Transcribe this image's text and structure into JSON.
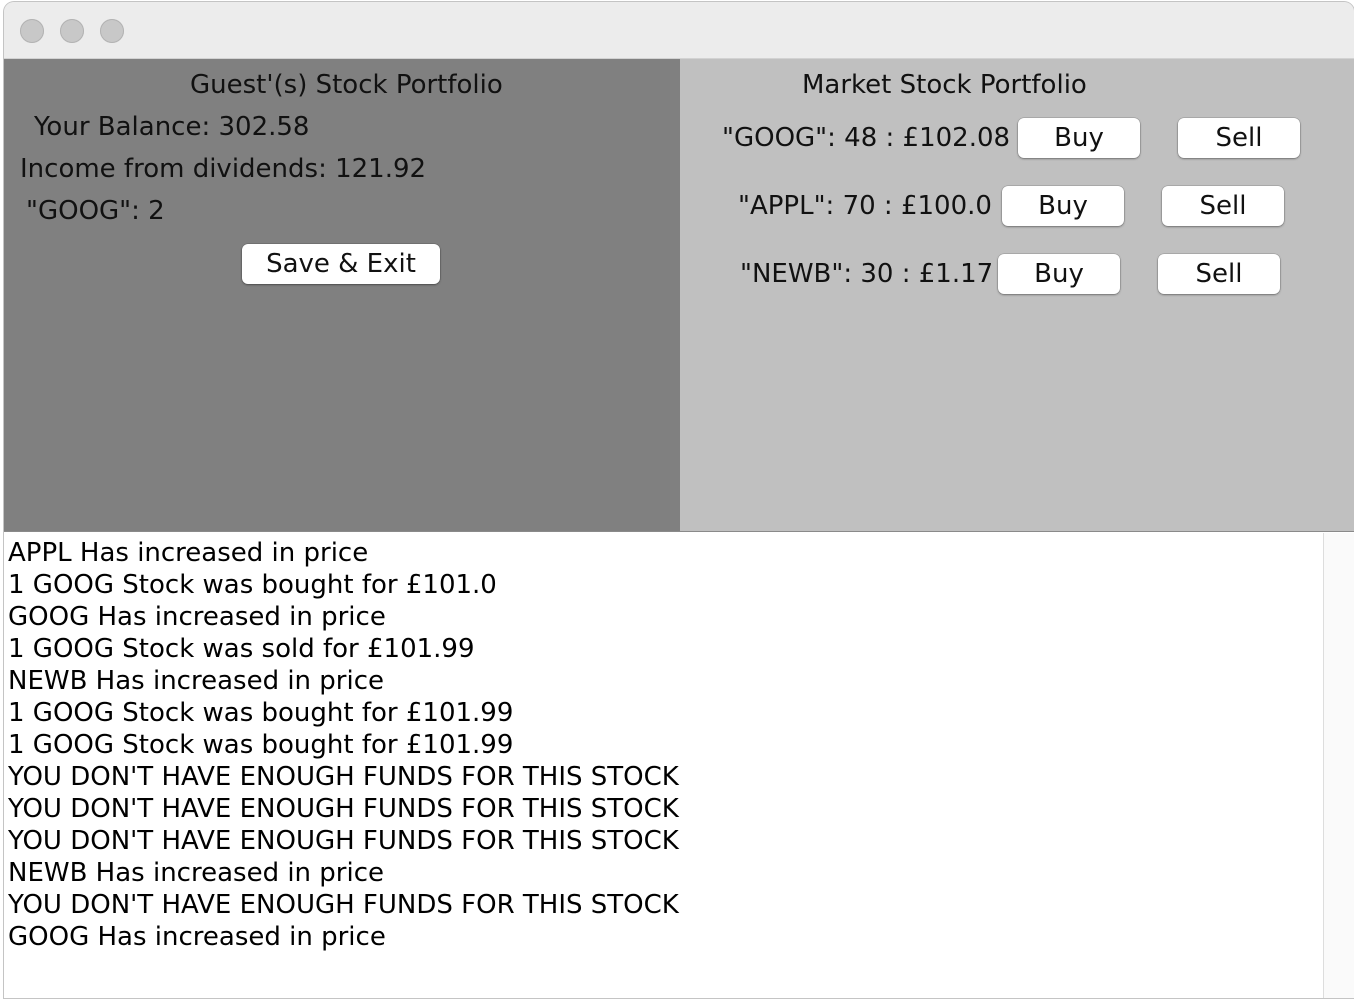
{
  "window": {
    "controls": [
      "close",
      "minimize",
      "zoom"
    ]
  },
  "portfolio": {
    "title": "Guest'(s) Stock Portfolio",
    "balance": "Your Balance: 302.58",
    "dividends": "Income from dividends: 121.92",
    "holdings": [
      "\"GOOG\": 2"
    ],
    "save_exit_label": "Save & Exit"
  },
  "market": {
    "title": "Market Stock Portfolio",
    "stocks": [
      {
        "label": "\"GOOG\": 48 : £102.08",
        "buy": "Buy",
        "sell": "Sell"
      },
      {
        "label": "\"APPL\": 70 : £100.0",
        "buy": "Buy",
        "sell": "Sell"
      },
      {
        "label": "\"NEWB\": 30 : £1.17",
        "buy": "Buy",
        "sell": "Sell"
      }
    ]
  },
  "log": {
    "lines": [
      "APPL Has increased in price",
      "1 GOOG Stock was bought for £101.0",
      "GOOG Has increased in price",
      "1 GOOG Stock was sold for £101.99",
      "NEWB Has increased in price",
      "1 GOOG Stock was bought for £101.99",
      "1 GOOG Stock was bought for £101.99",
      "YOU DON'T HAVE ENOUGH FUNDS FOR THIS STOCK",
      "YOU DON'T HAVE ENOUGH FUNDS FOR THIS STOCK",
      "YOU DON'T HAVE ENOUGH FUNDS FOR THIS STOCK",
      "NEWB Has increased in price",
      "YOU DON'T HAVE ENOUGH FUNDS FOR THIS STOCK",
      "GOOG Has increased in price"
    ]
  },
  "colors": {
    "portfolio_panel": "#808080",
    "market_panel": "#c0c0c0",
    "log_background": "#ffffff",
    "button_background": "#ffffff"
  }
}
